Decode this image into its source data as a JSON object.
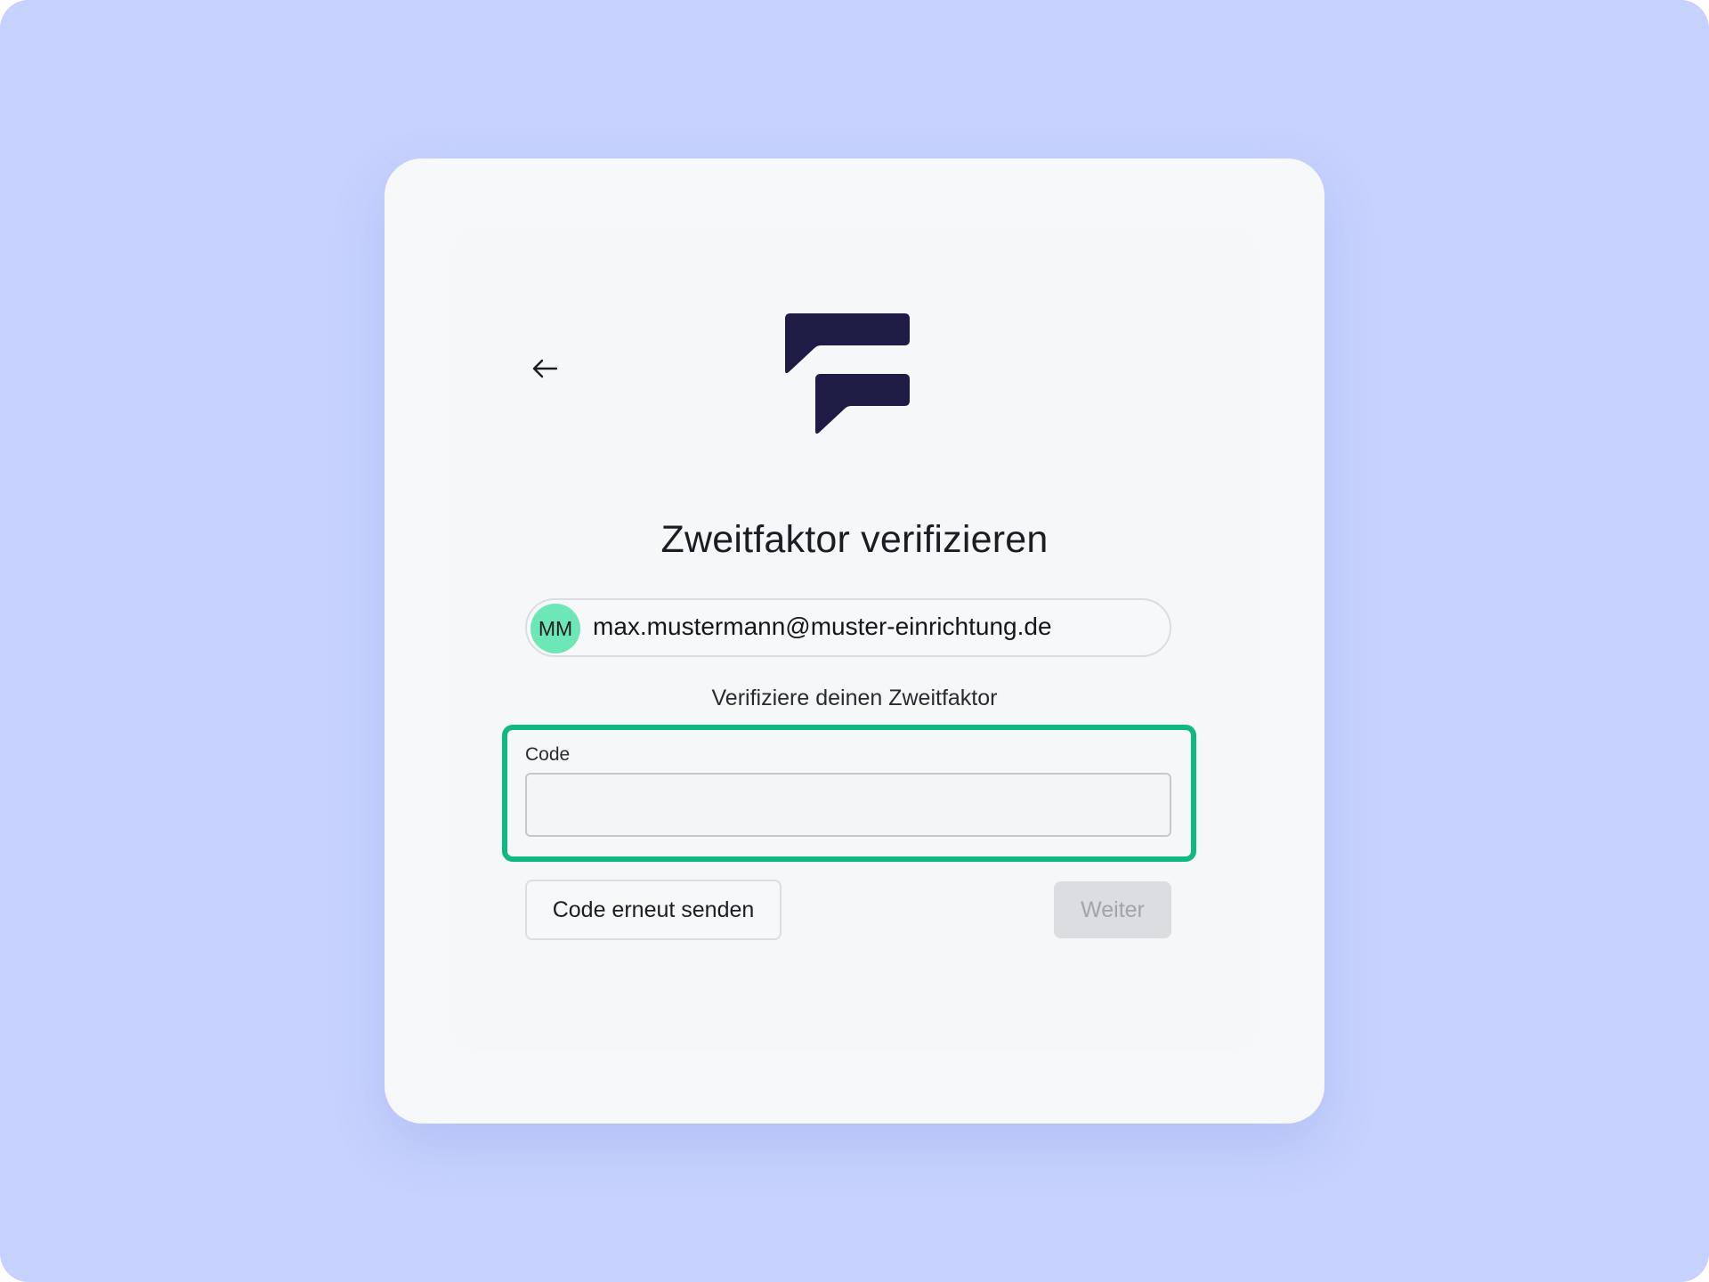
{
  "colors": {
    "backdrop": "#c7d2fe",
    "card": "#f7f8fa",
    "logo": "#1e1b44",
    "avatar": "#6ee7b7",
    "highlight": "#10b981",
    "disabled_button": "#dcdde0"
  },
  "header": {
    "back_icon": "arrow-left-icon",
    "logo": "brand-logo"
  },
  "main": {
    "title": "Zweitfaktor verifizieren",
    "account": {
      "initials": "MM",
      "email": "max.mustermann@muster-einrichtung.de"
    },
    "subtitle": "Verifiziere deinen Zweitfaktor",
    "code_field": {
      "label": "Code",
      "value": "",
      "placeholder": ""
    },
    "actions": {
      "resend_label": "Code erneut senden",
      "next_label": "Weiter",
      "next_disabled": true
    }
  }
}
